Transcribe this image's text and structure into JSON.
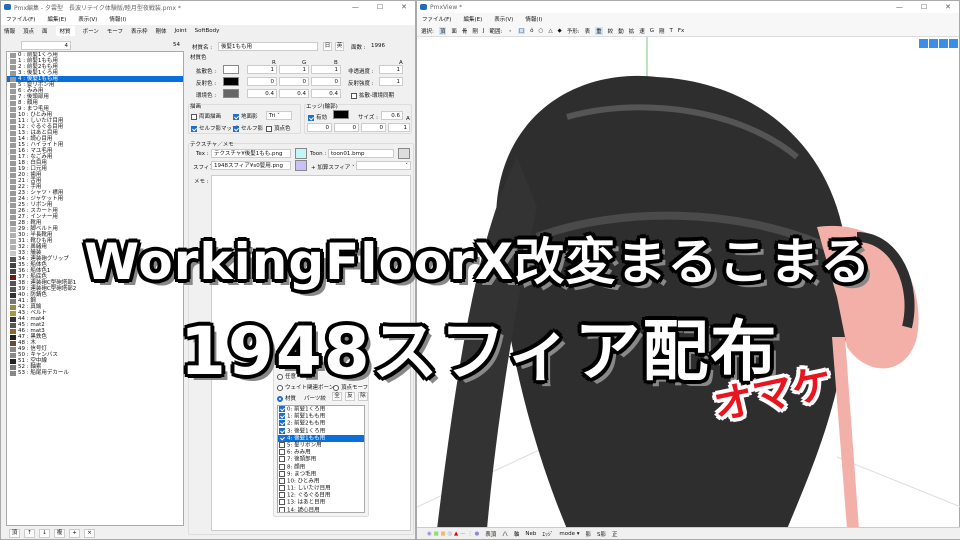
{
  "left": {
    "title": "Pmx編集 - 夕雲型　長波リテイク体験版/睦月型夜戦装.pmx *",
    "menu": [
      "ファイル(F)",
      "編集(E)",
      "表示(V)",
      "情報(I)"
    ],
    "tabs": [
      "情報",
      "頂点",
      "面",
      "材質",
      "ボーン",
      "モーフ",
      "表示枠",
      "剛体",
      "Joint",
      "SoftBody"
    ],
    "active_tab": "材質",
    "index_value": "4",
    "count": "54",
    "materials": [
      {
        "n": "0 : 前髪1くろ用",
        "c": "#9a9a9a"
      },
      {
        "n": "1 : 前髪1もも用",
        "c": "#9a9a9a"
      },
      {
        "n": "2 : 前髪2もも用",
        "c": "#9a9a9a"
      },
      {
        "n": "3 : 後髪1くろ用",
        "c": "#9a9a9a"
      },
      {
        "n": "4 : 後髪1もも用",
        "c": "#9a9a9a"
      },
      {
        "n": "5 : 髪リボン用",
        "c": "#9a9a9a"
      },
      {
        "n": "6 : みみ用",
        "c": "#9a9a9a"
      },
      {
        "n": "7 : 後頭部用",
        "c": "#9a9a9a"
      },
      {
        "n": "8 : 顔用",
        "c": "#9a9a9a"
      },
      {
        "n": "9 : まつ毛用",
        "c": "#9a9a9a"
      },
      {
        "n": "10 : ひとみ用",
        "c": "#9a9a9a"
      },
      {
        "n": "11 : しいたけ目用",
        "c": "#9a9a9a"
      },
      {
        "n": "12 : ぐるぐる目用",
        "c": "#9a9a9a"
      },
      {
        "n": "13 : はあと目用",
        "c": "#9a9a9a"
      },
      {
        "n": "14 : 読心目用",
        "c": "#9a9a9a"
      },
      {
        "n": "15 : ハイライト用",
        "c": "#9a9a9a"
      },
      {
        "n": "16 : マユ毛用",
        "c": "#9a9a9a"
      },
      {
        "n": "17 : なごみ用",
        "c": "#9a9a9a"
      },
      {
        "n": "18 : 白目用",
        "c": "#9a9a9a"
      },
      {
        "n": "19 : 口元用",
        "c": "#9a9a9a"
      },
      {
        "n": "20 : 歯用",
        "c": "#9a9a9a"
      },
      {
        "n": "21 : 舌用",
        "c": "#9a9a9a"
      },
      {
        "n": "22 : 手用",
        "c": "#9a9a9a"
      },
      {
        "n": "23 : シャツ・襟用",
        "c": "#9a9a9a"
      },
      {
        "n": "24 : ジャケット用",
        "c": "#9a9a9a"
      },
      {
        "n": "25 : リボン用",
        "c": "#9a9a9a"
      },
      {
        "n": "26 : スカート用",
        "c": "#9a9a9a"
      },
      {
        "n": "27 : インナー用",
        "c": "#9a9a9a"
      },
      {
        "n": "28 : 靴用",
        "c": "#9a9a9a"
      },
      {
        "n": "29 : 脚ベルト用",
        "c": "#b0b0b0"
      },
      {
        "n": "30 : 半長靴用",
        "c": "#b0b0b0"
      },
      {
        "n": "31 : 靴ひも用",
        "c": "#b0b0b0"
      },
      {
        "n": "32 : 鼻緒用",
        "c": "#b0b0b0"
      },
      {
        "n": "33 : 艤装",
        "c": "#c8c8c8"
      },
      {
        "n": "34 : 連装砲グリップ",
        "c": "#555"
      },
      {
        "n": "35 : 船体色",
        "c": "#444"
      },
      {
        "n": "36 : 船体色1",
        "c": "#444"
      },
      {
        "n": "37 : 船底色",
        "c": "#6a1a14"
      },
      {
        "n": "38 : 連装砲C型砲塔部1",
        "c": "#555"
      },
      {
        "n": "39 : 連装砲C型砲塔部2",
        "c": "#555"
      },
      {
        "n": "40 : 防錆色",
        "c": "#333"
      },
      {
        "n": "41 : 鋼",
        "c": "#777"
      },
      {
        "n": "42 : 真鍮",
        "c": "#a08a3a"
      },
      {
        "n": "43 : ベルト",
        "c": "#a89a40"
      },
      {
        "n": "44 : mat4",
        "c": "#333"
      },
      {
        "n": "45 : mat2",
        "c": "#555"
      },
      {
        "n": "46 : mat3",
        "c": "#8a6a2a"
      },
      {
        "n": "47 : 黒鉄色",
        "c": "#222"
      },
      {
        "n": "48 : 木",
        "c": "#6a4a30"
      },
      {
        "n": "49 : 信号灯",
        "c": "#888"
      },
      {
        "n": "50 : キャンバス",
        "c": "#888"
      },
      {
        "n": "51 : 空中線",
        "c": "#222"
      },
      {
        "n": "52 : 軸索",
        "c": "#777"
      },
      {
        "n": "53 : 船尾用デカール",
        "c": "#888"
      }
    ],
    "selected_material": 4,
    "list_buttons": [
      "頂",
      "↑",
      "↓",
      "複",
      "+",
      "×"
    ]
  },
  "props": {
    "name_label": "材質名 :",
    "name_value": "後髪1もも用",
    "btn_jp": "日",
    "btn_en": "英",
    "faces_label": "面数 :",
    "faces_value": "1996",
    "color_header": "材質色",
    "col_r": "R",
    "col_g": "G",
    "col_b": "B",
    "col_a": "A",
    "diffuse_label": "拡散色 :",
    "diffuse": [
      "1",
      "1",
      "1"
    ],
    "opacity_label": "非透過度 :",
    "opacity": "1",
    "diffuse_color": "#ffffff",
    "specular_label": "反射色 :",
    "specular": [
      "0",
      "0",
      "0"
    ],
    "spec_power_label": "反射強度 :",
    "spec_power": "1",
    "specular_color": "#000000",
    "ambient_label": "環境色 :",
    "ambient": [
      "0.4",
      "0.4",
      "0.4"
    ],
    "ambient_color": "#666666",
    "sync_label": "拡散-環境同期",
    "draw_header": "描画",
    "double_sided": "両面描画",
    "ground_shadow": "地面影",
    "tri": "Tri",
    "self_shadow_map": "セルフ影マップ",
    "self_shadow": "セルフ影",
    "vertex_color": "頂点色",
    "edge_header": "エッジ(輪郭)",
    "edge_enabled": "有効",
    "edge_size_label": "サイズ :",
    "edge_size": "0.6",
    "edge_a": "A",
    "edge_rgba": [
      "0",
      "0",
      "0",
      "1"
    ],
    "tex_header": "テクスチャ／メモ",
    "tex_label": "Tex :",
    "tex_value": "テクスチャ¥後髪1もも.png",
    "toon_label": "Toon :",
    "toon_value": "toon01.bmp",
    "sphere_label": "スフィア :",
    "sphere_value": "1948スフィア¥s0髪用.png",
    "sphere_mode": "+ 加算スフィア",
    "memo_label": "メモ :"
  },
  "filter": {
    "opt_any": "任意",
    "opt_weight": "ウェイト関連ボーン",
    "opt_vmorph": "頂点モーフ",
    "opt_material": "材質",
    "parts_label": "パーツ絞",
    "btn_all": "全",
    "btn_inv": "反",
    "btn_rem": "除",
    "items": [
      "0: 前髪1くろ用",
      "1: 前髪1もも用",
      "2: 前髪2もも用",
      "3: 後髪1くろ用",
      "4: 後髪1もも用",
      "5: 髪リボン用",
      "6: みみ用",
      "7: 後頭部用",
      "8: 顔用",
      "9: まつ毛用",
      "10: ひとみ用",
      "11: しいたけ目用",
      "12: ぐるぐる目用",
      "13: はあと目用",
      "14: 読心目用"
    ],
    "checked": [
      0,
      1,
      2,
      3,
      4
    ],
    "selected": 4
  },
  "right": {
    "title": "PmxView *",
    "menu": [
      "ファイル(F)",
      "編集(E)",
      "表示(V)",
      "情報(I)"
    ],
    "toolbar": [
      "選択:",
      "頂",
      "面",
      "骨",
      "剛",
      "J",
      "範囲:",
      "・",
      "□",
      "ô",
      "○",
      "△",
      "◆",
      "予形:",
      "表",
      "重",
      "絞",
      "動",
      "拡",
      "速",
      "G",
      "剛",
      "T",
      "Fx"
    ],
    "status": [
      "表頂",
      "八",
      "軸",
      "Neb",
      "ｴｯｼﾞ",
      "mode ▾",
      "影",
      "S影",
      "正"
    ]
  },
  "overlay": {
    "line1": "WorkingFloorX改変まるこまる",
    "line2": "1948スフィア配布",
    "omake": "オマケ"
  },
  "colors": {
    "accent": "#0a6fd8",
    "omake": "#e8141e",
    "hair": "#2e2e2e",
    "ribbon": "#f2b0a8"
  }
}
